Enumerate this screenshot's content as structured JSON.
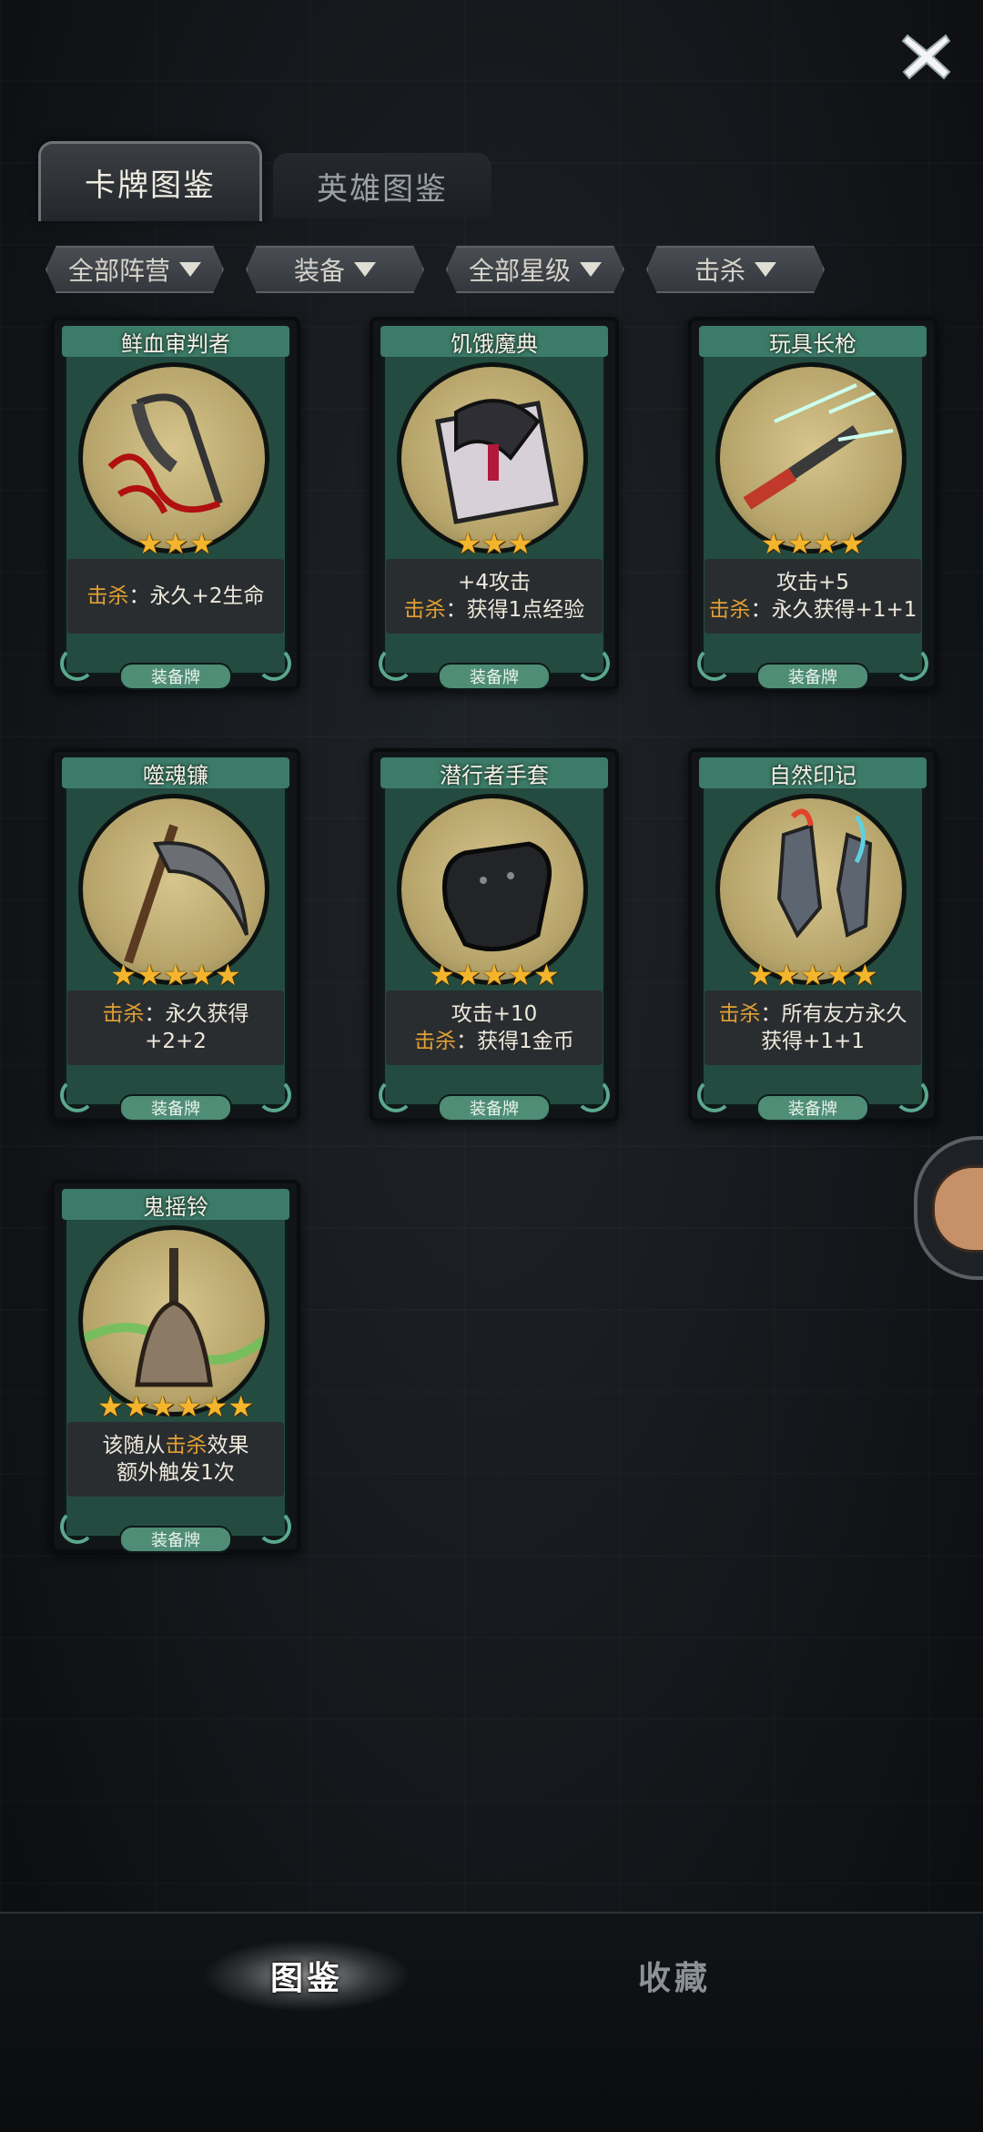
{
  "top_tabs": [
    {
      "label": "卡牌图鉴",
      "active": true
    },
    {
      "label": "英雄图鉴",
      "active": false
    }
  ],
  "filters": [
    {
      "label": "全部阵营"
    },
    {
      "label": "装备"
    },
    {
      "label": "全部星级"
    },
    {
      "label": "击杀"
    }
  ],
  "cards": [
    {
      "name": "鲜血审判者",
      "stars": "★★★",
      "desc_line1_prefix": "",
      "desc_line1_kill": "击杀",
      "desc_line1_suffix": "：永久+2生命",
      "desc_line2_kill": "",
      "desc_line2_suffix": "",
      "tag": "装备牌",
      "art_icon": "blood-scythe-icon"
    },
    {
      "name": "饥饿魔典",
      "stars": "★★★",
      "desc_line1_prefix": "+4攻击",
      "desc_line1_kill": "",
      "desc_line1_suffix": "",
      "desc_line2_kill": "击杀",
      "desc_line2_suffix": "：获得1点经验",
      "tag": "装备牌",
      "art_icon": "hungry-tome-icon"
    },
    {
      "name": "玩具长枪",
      "stars": "★★★★",
      "desc_line1_prefix": "攻击+5",
      "desc_line1_kill": "",
      "desc_line1_suffix": "",
      "desc_line2_kill": "击杀",
      "desc_line2_suffix": "：永久获得+1+1",
      "tag": "装备牌",
      "art_icon": "toy-lance-icon"
    },
    {
      "name": "噬魂镰",
      "stars": "★★★★★",
      "desc_line1_prefix": "",
      "desc_line1_kill": "击杀",
      "desc_line1_suffix": "：永久获得",
      "desc_line2_kill": "",
      "desc_line2_suffix": "+2+2",
      "tag": "装备牌",
      "art_icon": "soul-scythe-icon"
    },
    {
      "name": "潜行者手套",
      "stars": "★★★★★",
      "desc_line1_prefix": "攻击+10",
      "desc_line1_kill": "",
      "desc_line1_suffix": "",
      "desc_line2_kill": "击杀",
      "desc_line2_suffix": "：获得1金币",
      "tag": "装备牌",
      "art_icon": "glove-icon"
    },
    {
      "name": "自然印记",
      "stars": "★★★★★",
      "desc_line1_prefix": "",
      "desc_line1_kill": "击杀",
      "desc_line1_suffix": "：所有友方永久",
      "desc_line2_kill": "",
      "desc_line2_suffix": "获得+1+1",
      "tag": "装备牌",
      "art_icon": "nature-mark-icon"
    },
    {
      "name": "鬼摇铃",
      "stars": "★★★★★★",
      "desc_line1_prefix": "该随从",
      "desc_line1_kill": "击杀",
      "desc_line1_suffix": "效果",
      "desc_line2_kill": "",
      "desc_line2_suffix": "额外触发1次",
      "tag": "装备牌",
      "art_icon": "ghost-bell-icon"
    }
  ],
  "bottom_tabs": [
    {
      "label": "图鉴",
      "active": true
    },
    {
      "label": "收藏",
      "active": false
    }
  ],
  "colors": {
    "kill": "#e1a033",
    "card_frame": "#244b40",
    "star": "#f4b52c"
  }
}
